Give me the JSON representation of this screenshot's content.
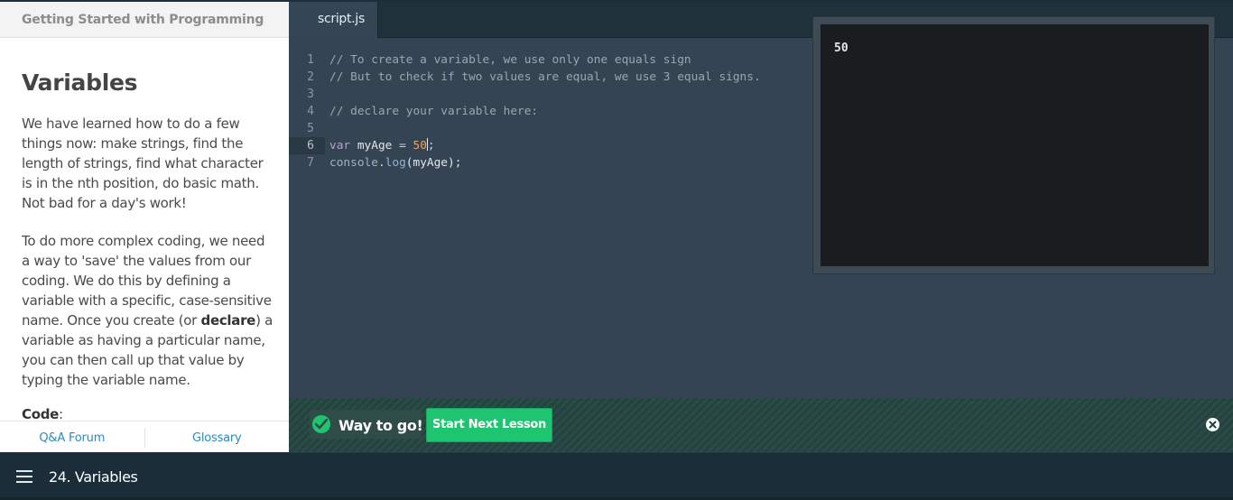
{
  "course": {
    "title": "Getting Started with Programming"
  },
  "lesson": {
    "heading": "Variables",
    "para1": "We have learned how to do a few things now: make strings, find the length of strings, find what character is in the nth position, do basic math. Not bad for a day's work!",
    "para2_a": "To do more complex coding, we need a way to 'save' the values from our coding. We do this by defining a variable with a specific, case-sensitive name. Once you create (or ",
    "para2_bold": "declare",
    "para2_b": ") a variable as having a particular name, you can then call up that value by typing the variable name.",
    "code_label": "Code",
    "code_colon": ":"
  },
  "footer": {
    "qa_label": "Q&A Forum",
    "glossary_label": "Glossary"
  },
  "editor": {
    "tab_label": "script.js",
    "line_numbers": [
      "1",
      "2",
      "3",
      "4",
      "5",
      "6",
      "7"
    ],
    "line1": "// To create a variable, we use only one equals sign",
    "line2": "// But to check if two values are equal, we use 3 equal signs.",
    "line4": "// declare your variable here:",
    "line6_kw": "var",
    "line6_ident": " myAge ",
    "line6_op": "=",
    "line6_num": "50",
    "line6_end": ";",
    "line7_obj": "console",
    "line7_dot": ".",
    "line7_fn": "log",
    "line7_args": "(myAge);"
  },
  "console": {
    "output": "50"
  },
  "success": {
    "message": "Way to go!",
    "next_button": "Start Next Lesson"
  },
  "bottom": {
    "lesson_label": "24. Variables"
  },
  "colors": {
    "accent_green": "#1ec46f",
    "link_blue": "#2a8bbf",
    "editor_bg": "#344452"
  },
  "icons": {
    "check": "check-circle-icon",
    "close": "close-circle-icon",
    "menu": "hamburger-menu-icon"
  }
}
